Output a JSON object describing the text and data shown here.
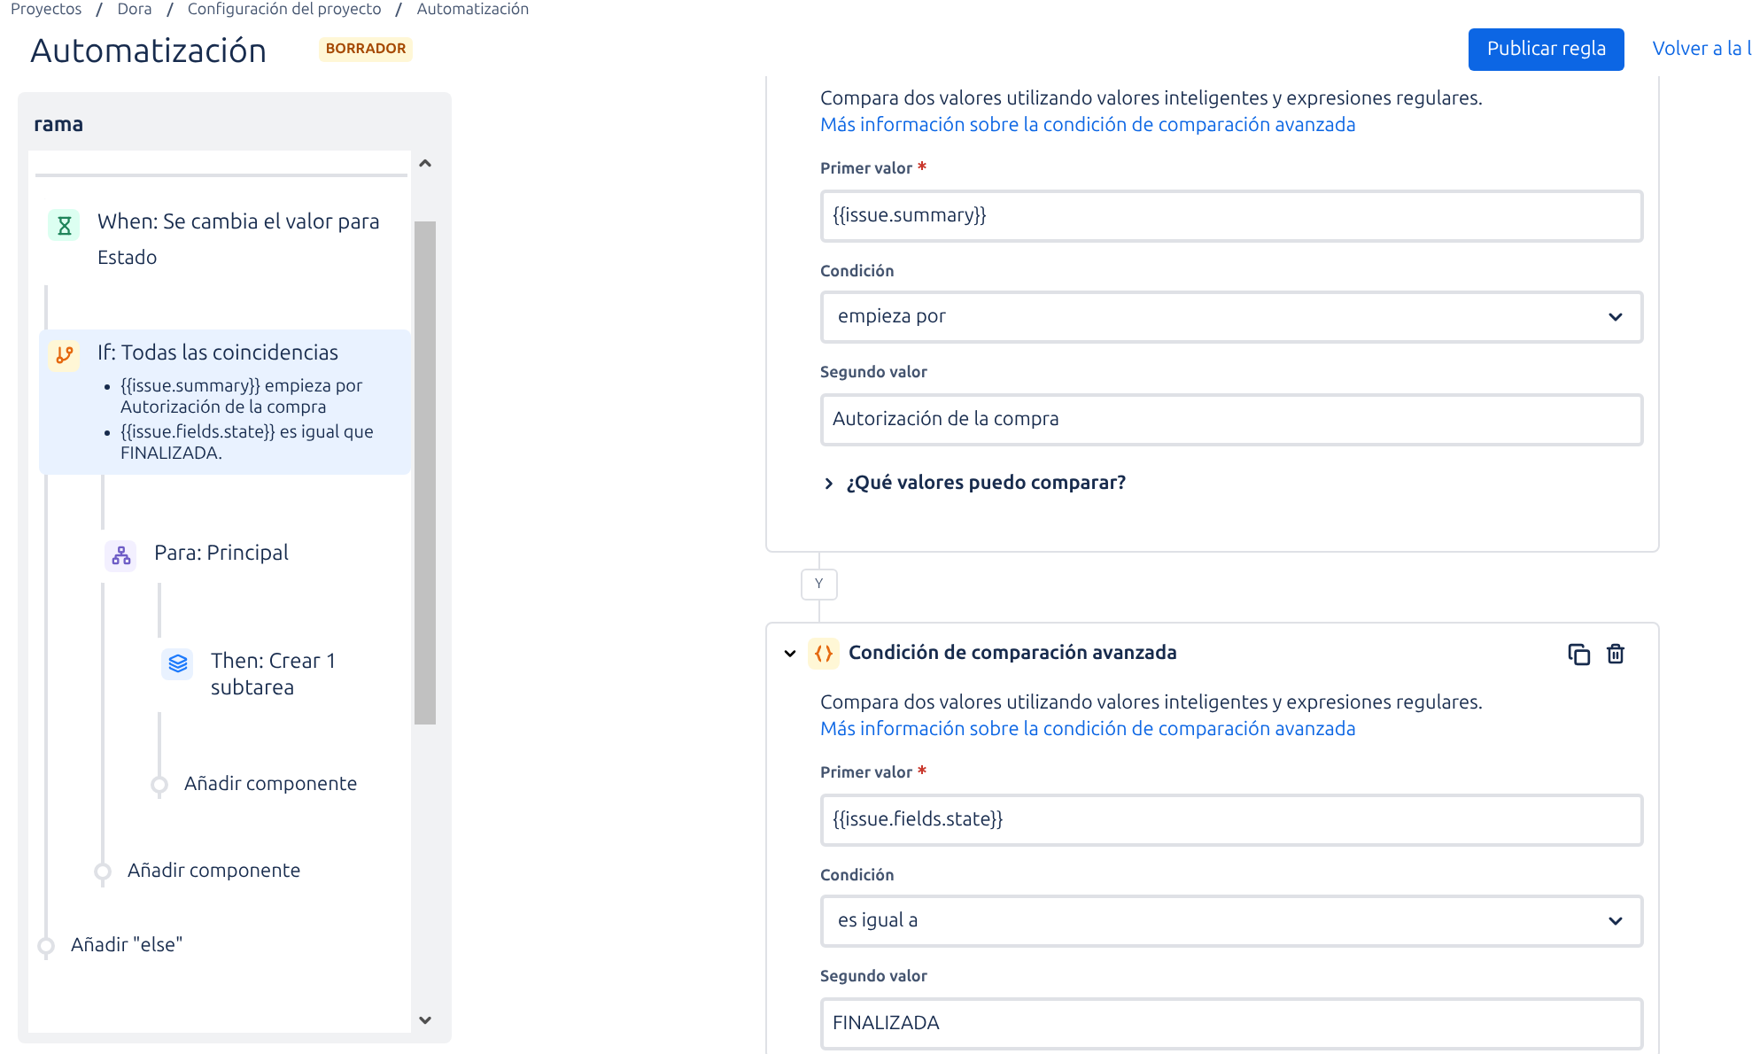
{
  "breadcrumb": [
    "Proyectos",
    "Dora",
    "Configuración del proyecto",
    "Automatización"
  ],
  "title": "Automatización",
  "status_badge": "BORRADOR",
  "publish_button": "Publicar regla",
  "back_link": "Volver a la l",
  "sidebar": {
    "title": "rama",
    "tree": [
      {
        "kind": "trigger",
        "title": "When: Se cambia el valor para",
        "detail": "Estado",
        "selected": false
      },
      {
        "kind": "condition",
        "title": "If: Todas las coincidencias",
        "selected": true,
        "bullets": [
          "{{issue.summary}} empieza por Autorización de la compra",
          "{{issue.fields.state}} es igual que FINALIZADA."
        ],
        "children": [
          {
            "kind": "branch",
            "title": "Para: Principal",
            "selected": false,
            "children": [
              {
                "kind": "action",
                "title": "Then: Crear 1 subtarea",
                "selected": false
              },
              {
                "kind": "add",
                "title": "Añadir componente"
              }
            ]
          },
          {
            "kind": "add",
            "title": "Añadir componente"
          }
        ]
      },
      {
        "kind": "add",
        "title": "Añadir \"else\""
      }
    ]
  },
  "conditions": [
    {
      "description": "Compara dos valores utilizando valores inteligentes y expresiones regulares.",
      "link": "Más información sobre la condición de comparación avanzada",
      "fields": [
        {
          "kind": "input",
          "label": "Primer valor",
          "required": true,
          "value": "{{issue.summary}}"
        },
        {
          "kind": "select",
          "label": "Condición",
          "required": false,
          "value": "empieza por"
        },
        {
          "kind": "input",
          "label": "Segundo valor",
          "required": false,
          "value": "Autorización de la compra"
        }
      ],
      "help": {
        "label": "¿Qué valores puedo comparar?",
        "expanded": false
      }
    },
    {
      "joiner": "Y",
      "expanded": true,
      "title": "Condición de comparación avanzada",
      "description": "Compara dos valores utilizando valores inteligentes y expresiones regulares.",
      "link": "Más información sobre la condición de comparación avanzada",
      "fields": [
        {
          "kind": "input",
          "label": "Primer valor",
          "required": true,
          "value": "{{issue.fields.state}}"
        },
        {
          "kind": "select",
          "label": "Condición",
          "required": false,
          "value": "es igual a"
        },
        {
          "kind": "input",
          "label": "Segundo valor",
          "required": false,
          "value": "FINALIZADA"
        }
      ]
    }
  ]
}
